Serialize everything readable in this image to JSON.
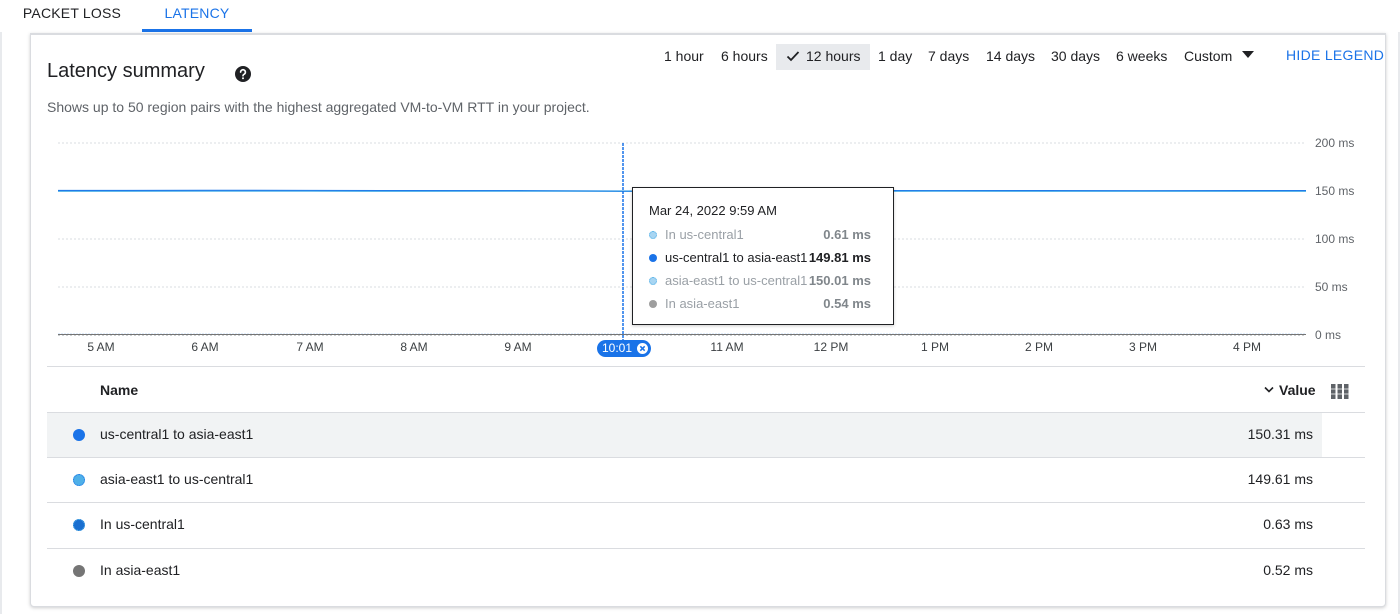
{
  "tabs": [
    "PACKET LOSS",
    "LATENCY"
  ],
  "summary": {
    "title": "Latency summary",
    "subtitle": "Shows up to 50 region pairs with the highest aggregated VM-to-VM RTT in your project."
  },
  "time_ranges": [
    "1 hour",
    "6 hours",
    "12 hours",
    "1 day",
    "7 days",
    "14 days",
    "30 days",
    "6 weeks",
    "Custom"
  ],
  "selected_range": "12 hours",
  "hide_legend_label": "HIDE LEGEND",
  "colors": {
    "accent": "#1a73e8",
    "series_main": "#1a73e8",
    "grid": "#dadce0",
    "gray_series": "#757575"
  },
  "cursor": {
    "label": "10:01"
  },
  "tooltip": {
    "date": "Mar 24, 2022 9:59 AM",
    "rows": [
      {
        "name": "In us-central1",
        "value": "0.61 ms",
        "highlighted": false
      },
      {
        "name": "us-central1 to asia-east1",
        "value": "149.81 ms",
        "highlighted": true
      },
      {
        "name": "asia-east1 to us-central1",
        "value": "150.01 ms",
        "highlighted": false
      },
      {
        "name": "In asia-east1",
        "value": "0.54 ms",
        "highlighted": false
      }
    ]
  },
  "chart_data": {
    "type": "line",
    "x": [
      "5 AM",
      "6 AM",
      "7 AM",
      "8 AM",
      "9 AM",
      "10:01",
      "11 AM",
      "12 PM",
      "1 PM",
      "2 PM",
      "3 PM",
      "4 PM"
    ],
    "y_ticks": [
      "200 ms",
      "150 ms",
      "100 ms",
      "50 ms",
      "0 ms"
    ],
    "ylim": [
      0,
      200
    ],
    "grid": true,
    "series": [
      {
        "name": "us-central1 to asia-east1",
        "values": [
          150.3,
          150.5,
          150.3,
          150.2,
          150.2,
          149.8,
          150.2,
          150.1,
          150.2,
          150.2,
          150.1,
          150.2
        ]
      },
      {
        "name": "asia-east1 to us-central1",
        "values": [
          149.6,
          149.8,
          149.7,
          149.6,
          149.7,
          150.0,
          149.6,
          149.6,
          149.7,
          149.6,
          149.6,
          149.6
        ]
      },
      {
        "name": "In us-central1",
        "values": [
          0.6,
          0.6,
          0.6,
          0.6,
          0.6,
          0.61,
          0.6,
          0.6,
          0.6,
          0.6,
          0.6,
          0.6
        ]
      },
      {
        "name": "In asia-east1",
        "values": [
          0.5,
          0.5,
          0.5,
          0.5,
          0.5,
          0.54,
          0.5,
          0.5,
          0.5,
          0.5,
          0.5,
          0.5
        ]
      }
    ]
  },
  "table": {
    "col_name": "Name",
    "col_value": "Value",
    "rows": [
      {
        "name": "us-central1 to asia-east1",
        "value": "150.31 ms",
        "color": "#1a73e8"
      },
      {
        "name": "asia-east1 to us-central1",
        "value": "149.61 ms",
        "color": "#4fb0e8"
      },
      {
        "name": "In us-central1",
        "value": "0.63 ms",
        "color": "#1a6fd0"
      },
      {
        "name": "In asia-east1",
        "value": "0.52 ms",
        "color": "#757575"
      }
    ]
  }
}
